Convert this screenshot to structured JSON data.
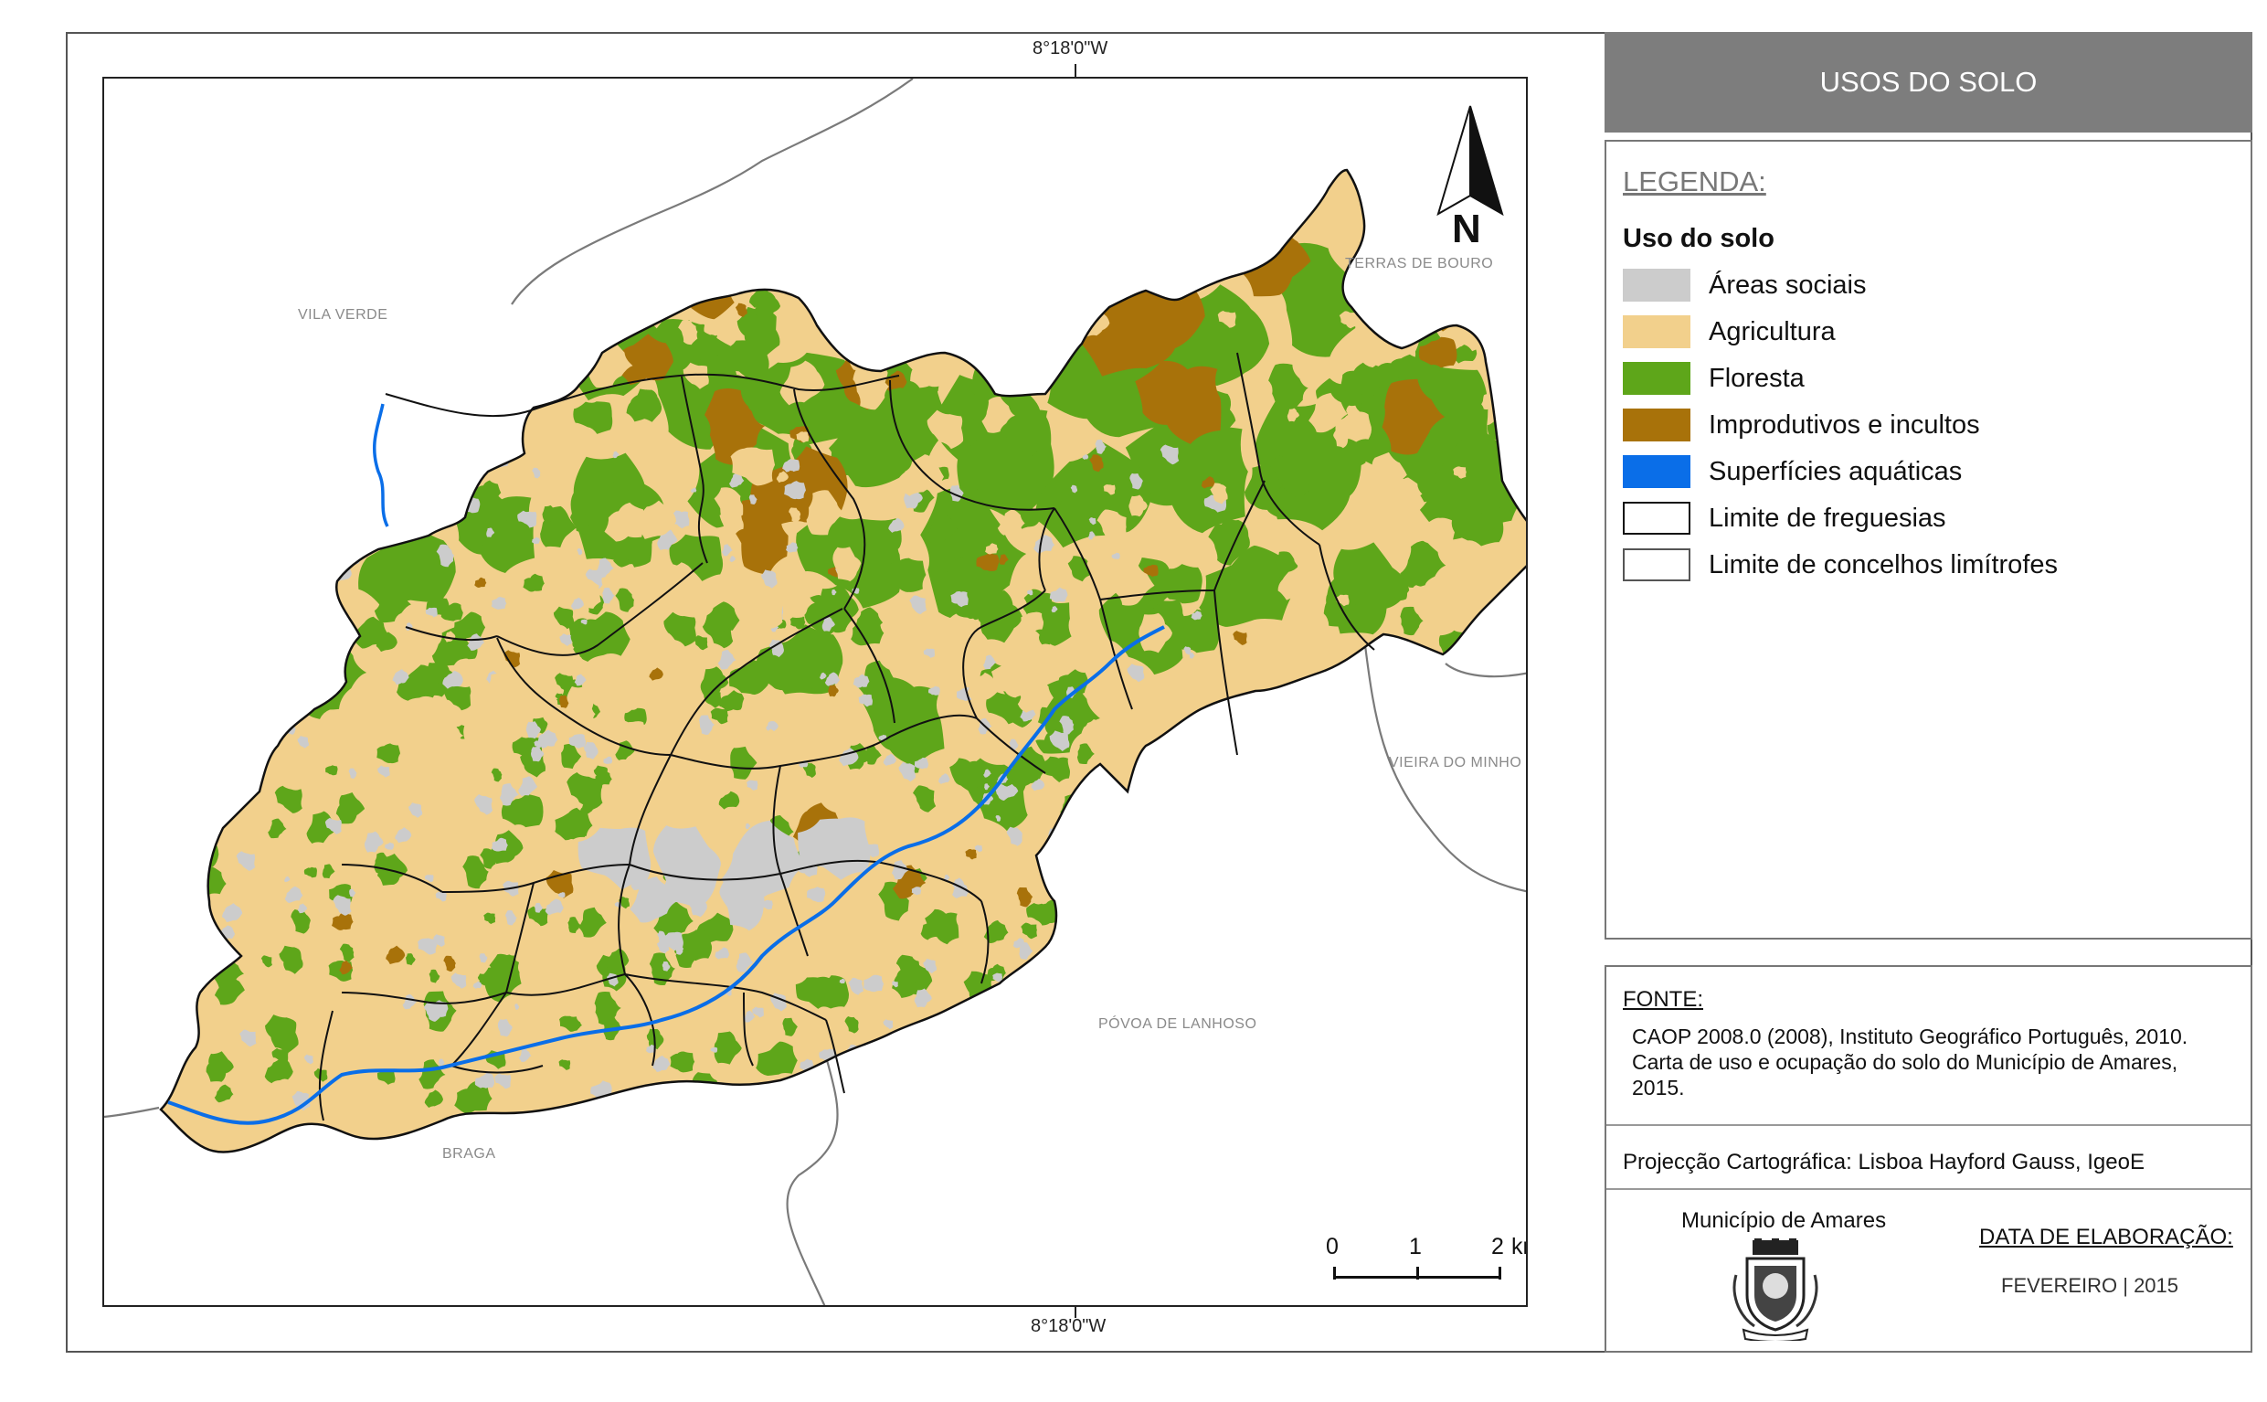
{
  "map": {
    "coord_top": "8°18'0\"W",
    "coord_bottom": "8°18'0\"W",
    "north_label": "N",
    "neighbors": [
      {
        "id": "vila-verde",
        "label": "VILA VERDE"
      },
      {
        "id": "terras-de-bouro",
        "label": "TERRAS DE BOURO"
      },
      {
        "id": "vieira-do-minho",
        "label": "VIEIRA DO MINHO"
      },
      {
        "id": "povoa-de-lanhoso",
        "label": "PÓVOA DE LANHOSO"
      },
      {
        "id": "braga",
        "label": "BRAGA"
      }
    ],
    "scale_bar": {
      "ticks": [
        "0",
        "1",
        "2"
      ],
      "unit": "km"
    },
    "colors": {
      "areas_sociais": "#cccccc",
      "agricultura": "#f2d08c",
      "floresta": "#5ea61a",
      "improdutivos": "#a8720a",
      "superficies_aquaticas": "#0a6ee8",
      "boundary": "#111111"
    }
  },
  "panel": {
    "title": "USOS DO SOLO",
    "legend": {
      "heading": "LEGENDA:",
      "subtitle": "Uso do solo",
      "items": [
        {
          "label": "Áreas sociais",
          "color": "#cccccc"
        },
        {
          "label": "Agricultura",
          "color": "#f2d08c"
        },
        {
          "label": "Floresta",
          "color": "#5ea61a"
        },
        {
          "label": "Improdutivos e incultos",
          "color": "#a8720a"
        },
        {
          "label": "Superfícies aquáticas",
          "color": "#0a6ee8"
        },
        {
          "label": "Limite de freguesias",
          "color": "#ffffff"
        },
        {
          "label": "Limite de concelhos limítrofes",
          "color": "#ffffff"
        }
      ]
    },
    "source": {
      "heading": "FONTE:",
      "lines": [
        "CAOP 2008.0 (2008), Instituto Geográfico Português, 2010.",
        "Carta de uso e ocupação do solo do Município de Amares,",
        "2015."
      ]
    },
    "projection": "Projecção Cartográfica: Lisboa Hayford Gauss, IgeoE",
    "municipality": "Município de Amares",
    "date_heading": "DATA DE ELABORAÇÃO:",
    "date_value": "FEVEREIRO | 2015"
  }
}
